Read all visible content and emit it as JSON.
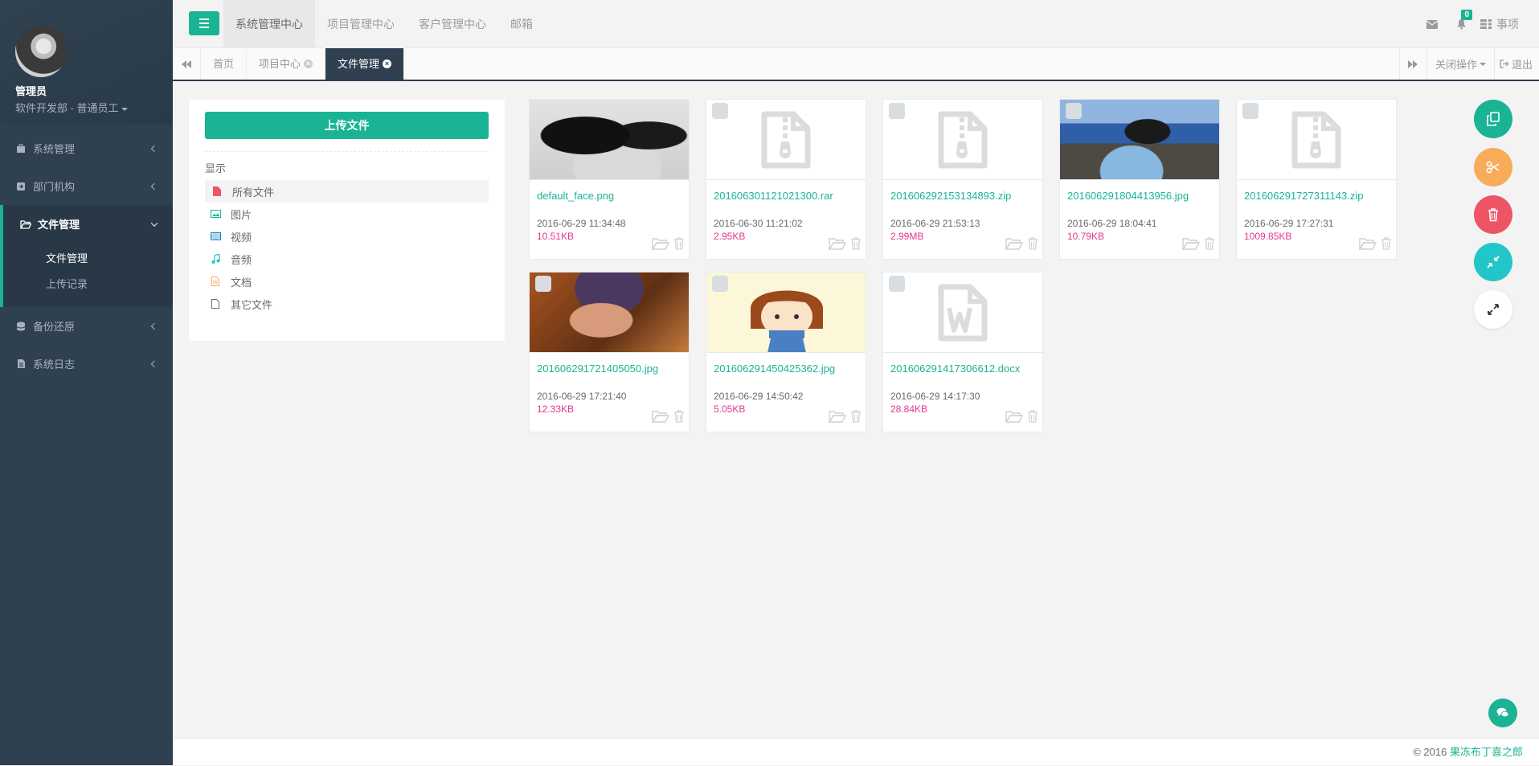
{
  "user": {
    "name": "管理员",
    "role": "软件开发部 - 普通员工"
  },
  "sidebar": {
    "items": [
      {
        "label": "系统管理",
        "icon": "briefcase-icon"
      },
      {
        "label": "部门机构",
        "icon": "sign-in-icon"
      },
      {
        "label": "文件管理",
        "icon": "folder-open-icon",
        "active": true,
        "children": [
          {
            "label": "文件管理"
          },
          {
            "label": "上传记录"
          }
        ]
      },
      {
        "label": "备份还原",
        "icon": "database-icon"
      },
      {
        "label": "系统日志",
        "icon": "file-text-icon"
      }
    ]
  },
  "topnav": {
    "tabs": [
      "系统管理中心",
      "项目管理中心",
      "客户管理中心",
      "邮箱"
    ],
    "notification_count": "0",
    "tasks_label": "事项"
  },
  "content_tabs": {
    "tabs": [
      {
        "label": "首页"
      },
      {
        "label": "项目中心"
      },
      {
        "label": "文件管理"
      }
    ],
    "close_ops": "关闭操作",
    "logout": "退出"
  },
  "filter_panel": {
    "upload_label": "上传文件",
    "show_label": "显示",
    "filters": [
      "所有文件",
      "图片",
      "视频",
      "音频",
      "文档",
      "其它文件"
    ]
  },
  "files": [
    {
      "name": "default_face.png",
      "date": "2016-06-29 11:34:48",
      "size": "10.51KB",
      "thumb": "photo-face"
    },
    {
      "name": "201606301121021300.rar",
      "date": "2016-06-30 11:21:02",
      "size": "2.95KB",
      "thumb": "zip-icon"
    },
    {
      "name": "201606292153134893.zip",
      "date": "2016-06-29 21:53:13",
      "size": "2.99MB",
      "thumb": "zip-icon"
    },
    {
      "name": "201606291804413956.jpg",
      "date": "2016-06-29 18:04:41",
      "size": "10.79KB",
      "thumb": "photo-sea"
    },
    {
      "name": "201606291727311143.zip",
      "date": "2016-06-29 17:27:31",
      "size": "1009.85KB",
      "thumb": "zip-icon"
    },
    {
      "name": "201606291721405050.jpg",
      "date": "2016-06-29 17:21:40",
      "size": "12.33KB",
      "thumb": "photo-pig"
    },
    {
      "name": "201606291450425362.jpg",
      "date": "2016-06-29 14:50:42",
      "size": "5.05KB",
      "thumb": "photo-girl"
    },
    {
      "name": "201606291417306612.docx",
      "date": "2016-06-29 14:17:30",
      "size": "28.84KB",
      "thumb": "word-icon"
    }
  ],
  "footer": {
    "copyright": "© 2016",
    "author": "果冻布丁喜之郎"
  },
  "colors": {
    "primary": "#1ab394",
    "sidebar": "#2f4050",
    "warning": "#f8ac59",
    "danger": "#ed5565",
    "info": "#23c6c8",
    "size_text": "#e5368a"
  }
}
